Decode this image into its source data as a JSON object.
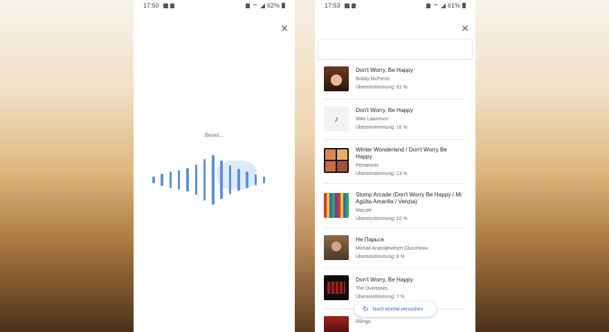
{
  "left_phone": {
    "status": {
      "time": "17:50",
      "battery": "62%"
    },
    "ready_text": "Bereit...",
    "wave_levels": [
      0.15,
      0.25,
      0.32,
      0.38,
      0.48,
      0.6,
      0.82,
      1.0,
      0.78,
      0.58,
      0.44,
      0.32,
      0.22,
      0.15
    ]
  },
  "right_phone": {
    "status": {
      "time": "17:53",
      "battery": "61%"
    },
    "results": [
      {
        "title": "Don't Worry, Be Happy",
        "artist": "Bobby McFerrin",
        "match": "Übereinstimmung: 61 %",
        "icon": "album-art"
      },
      {
        "title": "Don't Worry, Be Happy",
        "artist": "Mike Lawrence",
        "match": "Übereinstimmung: 16 %",
        "icon": "music-note-icon"
      },
      {
        "title": "Winter Wonderland / Don't Worry Be Happy",
        "artist": "Pentatonix",
        "match": "Übereinstimmung: 13 %",
        "icon": "album-art"
      },
      {
        "title": "Stomp Arcade (Don't Worry Be Happy / Mi Agüita Amarilla / Venzia)",
        "artist": "Macute",
        "match": "Übereinstimmung: 10 %",
        "icon": "album-art"
      },
      {
        "title": "Не Парься",
        "artist": "Michail Anatoljewitsch Gluschkow",
        "match": "Übereinstimmung: 8 %",
        "icon": "album-art"
      },
      {
        "title": "Don't Worry, Be Happy",
        "artist": "The Overtones",
        "match": "Übereinstimmung: 7 %",
        "icon": "album-art"
      },
      {
        "title": "",
        "artist": "Rilingo",
        "match": "",
        "icon": "album-art"
      }
    ],
    "retry_label": "Noch einmal versuchen"
  }
}
